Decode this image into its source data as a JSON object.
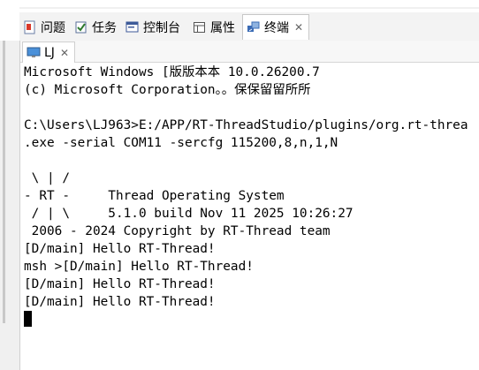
{
  "tabs": [
    {
      "label": "问题",
      "icon": "problems-icon"
    },
    {
      "label": "任务",
      "icon": "tasks-icon"
    },
    {
      "label": "控制台",
      "icon": "console-icon"
    },
    {
      "label": "属性",
      "icon": "properties-icon"
    },
    {
      "label": "终端",
      "icon": "terminal-icon",
      "active": true,
      "close": "✕"
    }
  ],
  "terminal_tab": {
    "label": "LJ",
    "close": "✕",
    "icon": "monitor-icon"
  },
  "console_lines": [
    "Microsoft Windows [版版本本 10.0.26200.7",
    "(c) Microsoft Corporation。。保保留留所所",
    "",
    "C:\\Users\\LJ963>E:/APP/RT-ThreadStudio/plugins/org.rt-threa",
    ".exe -serial COM11 -sercfg 115200,8,n,1,N",
    "",
    " \\ | /",
    "- RT -     Thread Operating System",
    " / | \\     5.1.0 build Nov 11 2025 10:26:27",
    " 2006 - 2024 Copyright by RT-Thread team",
    "[D/main] Hello RT-Thread!",
    "msh >[D/main] Hello RT-Thread!",
    "[D/main] Hello RT-Thread!",
    "[D/main] Hello RT-Thread!"
  ]
}
